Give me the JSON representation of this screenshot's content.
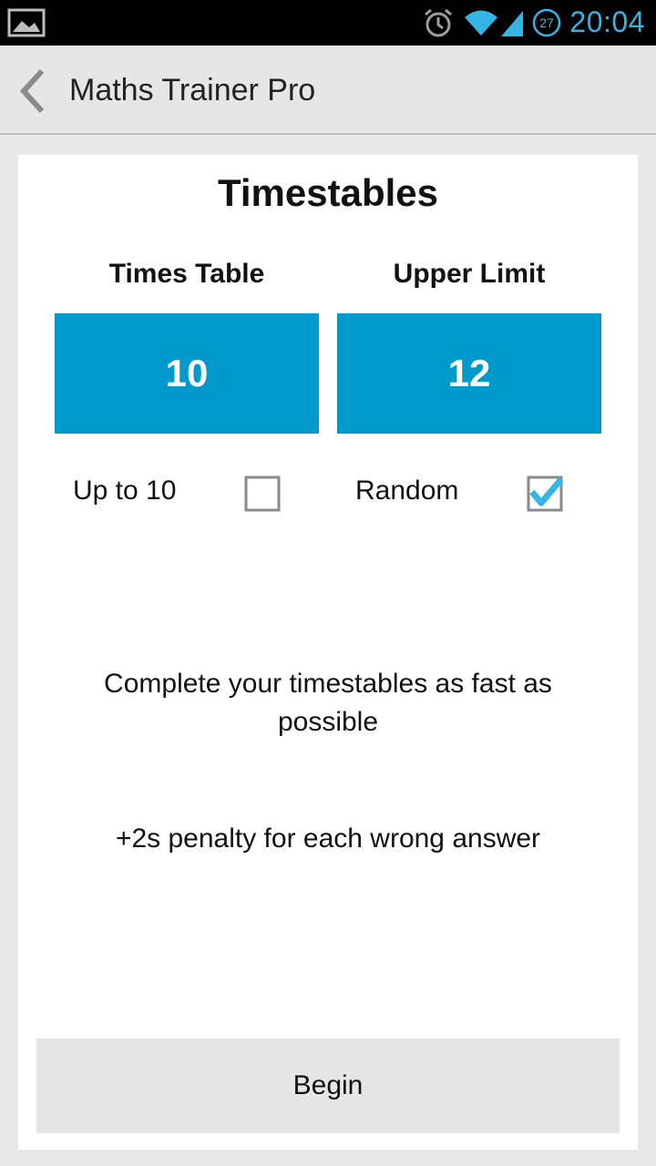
{
  "status_bar": {
    "time": "20:04",
    "notification_count": "27",
    "icons": [
      "gallery-icon",
      "alarm-icon",
      "wifi-icon",
      "signal-icon",
      "badge-icon"
    ],
    "accent_color": "#33b5e5"
  },
  "action_bar": {
    "title": "Maths Trainer Pro",
    "back_icon": "chevron-left-icon"
  },
  "screen": {
    "title": "Timestables",
    "times_table": {
      "label": "Times Table",
      "value": "10"
    },
    "upper_limit": {
      "label": "Upper Limit",
      "value": "12"
    },
    "options": {
      "up_to_10": {
        "label": "Up to 10",
        "checked": false
      },
      "random": {
        "label": "Random",
        "checked": true
      }
    },
    "description": "Complete your timestables as fast as possible",
    "penalty": "+2s penalty for each wrong answer",
    "begin_label": "Begin"
  },
  "colors": {
    "value_box": "#0099cc",
    "check_mark": "#33b5e5"
  }
}
